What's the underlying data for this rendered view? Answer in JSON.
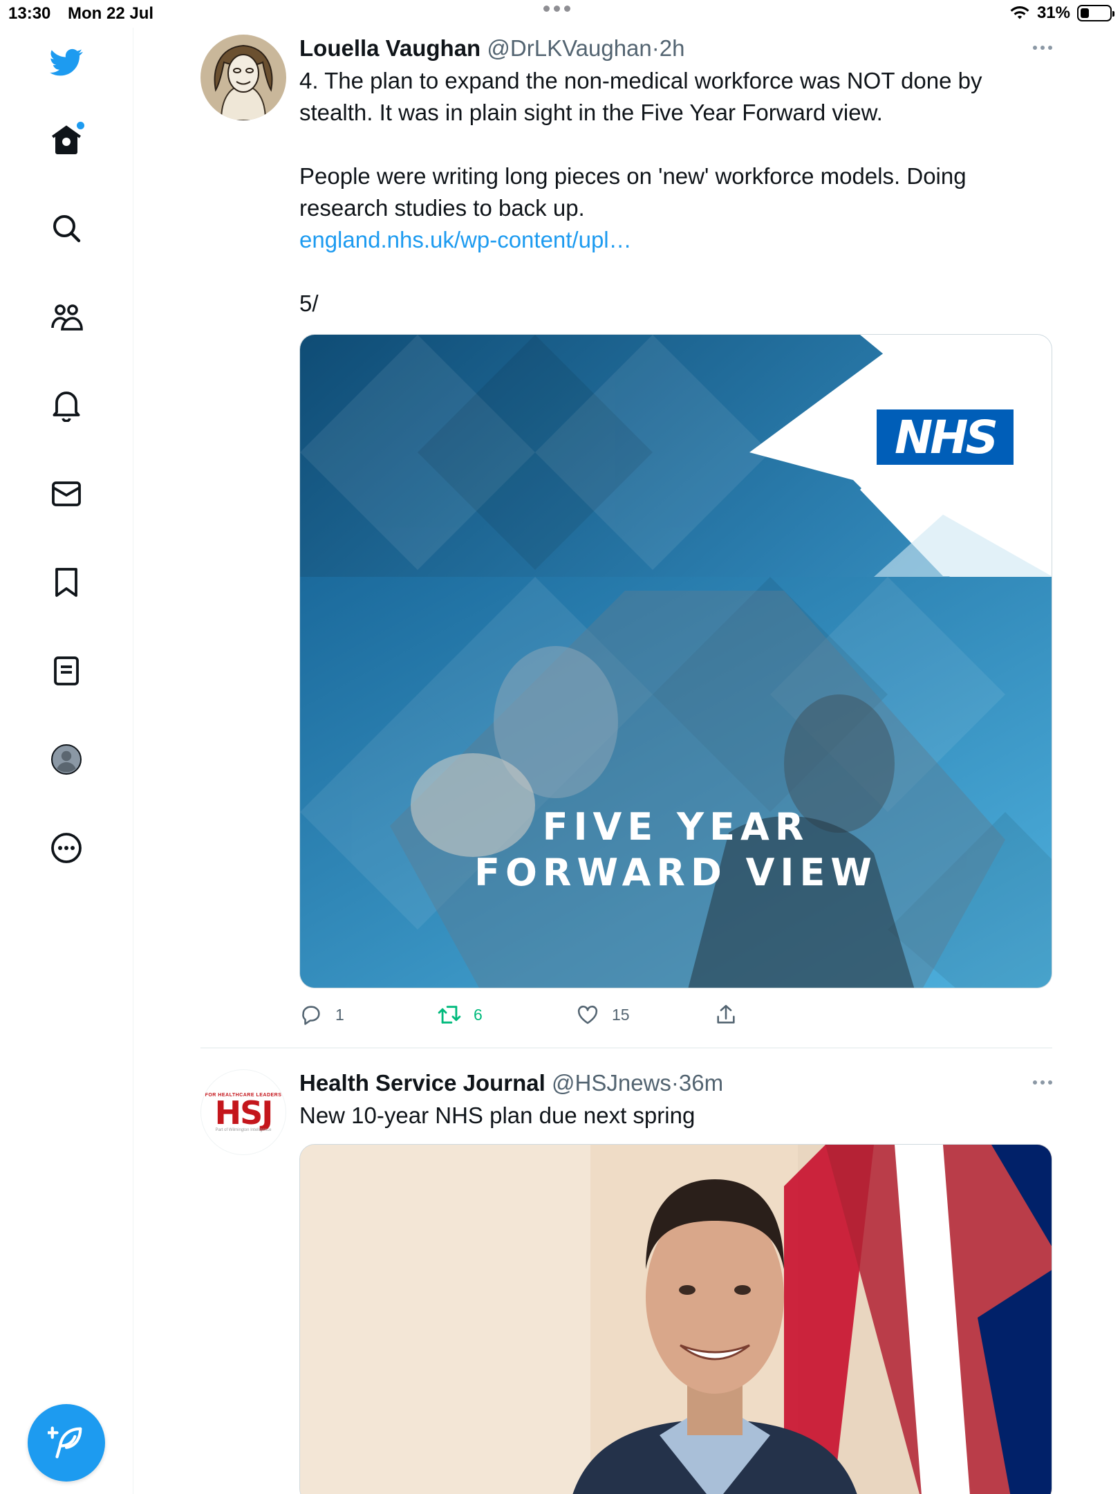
{
  "status_bar": {
    "time": "13:30",
    "date": "Mon 22 Jul",
    "battery_percent": "31%",
    "battery_level": 0.31
  },
  "sidebar": {
    "items": [
      {
        "name": "twitter-logo-icon"
      },
      {
        "name": "home-icon",
        "has_notification_dot": true
      },
      {
        "name": "search-icon"
      },
      {
        "name": "communities-icon"
      },
      {
        "name": "notifications-icon"
      },
      {
        "name": "messages-icon"
      },
      {
        "name": "bookmarks-icon"
      },
      {
        "name": "lists-icon"
      },
      {
        "name": "profile-icon"
      },
      {
        "name": "more-icon"
      }
    ],
    "compose_icon": "feather-plus-icon",
    "accent_color": "#1d9bf0"
  },
  "tweets": [
    {
      "author": "Louella Vaughan",
      "handle": "@DrLKVaughan",
      "separator": "·",
      "time": "2h",
      "text_1": "4. The plan to expand the non-medical workforce was NOT done by stealth. It was in plain sight in the Five Year Forward view.",
      "text_2": "People were writing long pieces on 'new' workforce models. Doing research studies to back up.",
      "link": "england.nhs.uk/wp-content/upl…",
      "text_3": "5/",
      "media": {
        "logo_text": "NHS",
        "title_line_1": "FIVE YEAR",
        "title_line_2": "FORWARD VIEW"
      },
      "replies": "1",
      "retweets": "6",
      "likes": "15"
    },
    {
      "author": "Health Service Journal",
      "handle": "@HSJnews",
      "separator": "·",
      "time": "36m",
      "text_1": "New 10-year NHS plan due next spring",
      "avatar_logo": {
        "top": "FOR HEALTHCARE LEADERS",
        "main": "HSJ",
        "sub": "Part of Wilmington Intelligence"
      }
    }
  ]
}
